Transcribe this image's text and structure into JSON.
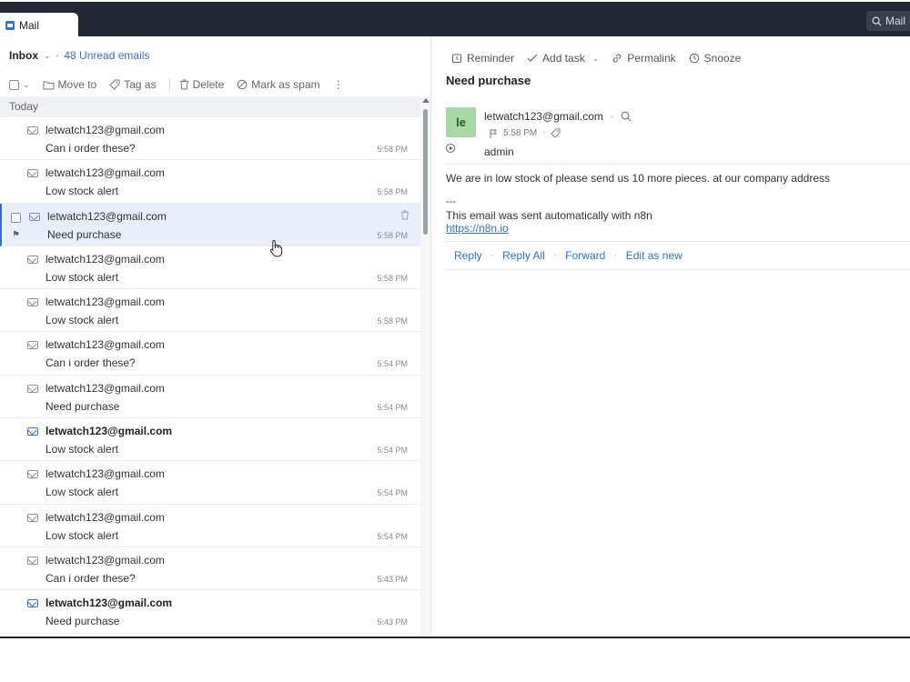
{
  "app": {
    "tab_label": "Mail",
    "search_label": "Mail"
  },
  "folder": {
    "name": "Inbox",
    "unread_label": "48 Unread emails"
  },
  "toolbar": {
    "move_to": "Move to",
    "tag_as": "Tag as",
    "delete": "Delete",
    "mark_spam": "Mark as spam"
  },
  "section": {
    "label": "Today"
  },
  "emails": [
    {
      "from": "letwatch123@gmail.com",
      "subject": "Can i order these?",
      "time": "5:58 PM",
      "unread": false,
      "selected": false
    },
    {
      "from": "letwatch123@gmail.com",
      "subject": "Low stock alert",
      "time": "5:58 PM",
      "unread": false,
      "selected": false
    },
    {
      "from": "letwatch123@gmail.com",
      "subject": "Need purchase",
      "time": "5:58 PM",
      "unread": false,
      "selected": true
    },
    {
      "from": "letwatch123@gmail.com",
      "subject": "Low stock alert",
      "time": "5:58 PM",
      "unread": false,
      "selected": false
    },
    {
      "from": "letwatch123@gmail.com",
      "subject": "Low stock alert",
      "time": "5:58 PM",
      "unread": false,
      "selected": false
    },
    {
      "from": "letwatch123@gmail.com",
      "subject": "Can i order these?",
      "time": "5:54 PM",
      "unread": false,
      "selected": false
    },
    {
      "from": "letwatch123@gmail.com",
      "subject": "Need purchase",
      "time": "5:54 PM",
      "unread": false,
      "selected": false
    },
    {
      "from": "letwatch123@gmail.com",
      "subject": "Low stock alert",
      "time": "5:54 PM",
      "unread": true,
      "selected": false
    },
    {
      "from": "letwatch123@gmail.com",
      "subject": "Low stock alert",
      "time": "5:54 PM",
      "unread": false,
      "selected": false
    },
    {
      "from": "letwatch123@gmail.com",
      "subject": "Low stock alert",
      "time": "5:54 PM",
      "unread": false,
      "selected": false
    },
    {
      "from": "letwatch123@gmail.com",
      "subject": "Can i order these?",
      "time": "5:43 PM",
      "unread": false,
      "selected": false
    },
    {
      "from": "letwatch123@gmail.com",
      "subject": "Need purchase",
      "time": "5:43 PM",
      "unread": true,
      "selected": false
    }
  ],
  "reader": {
    "toolbar": {
      "reminder": "Reminder",
      "add_task": "Add task",
      "permalink": "Permalink",
      "snooze": "Snooze"
    },
    "subject": "Need purchase",
    "avatar_initials": "le",
    "from": "letwatch123@gmail.com",
    "time": "5:58 PM",
    "to": "admin",
    "body": "We are in low stock of please send us 10 more pieces. at our company address",
    "sig_dashes": "---",
    "sig_line": "This email was sent automatically with n8n",
    "sig_link": "https://n8n.io",
    "actions": {
      "reply": "Reply",
      "reply_all": "Reply All",
      "forward": "Forward",
      "edit_as_new": "Edit as new"
    }
  }
}
